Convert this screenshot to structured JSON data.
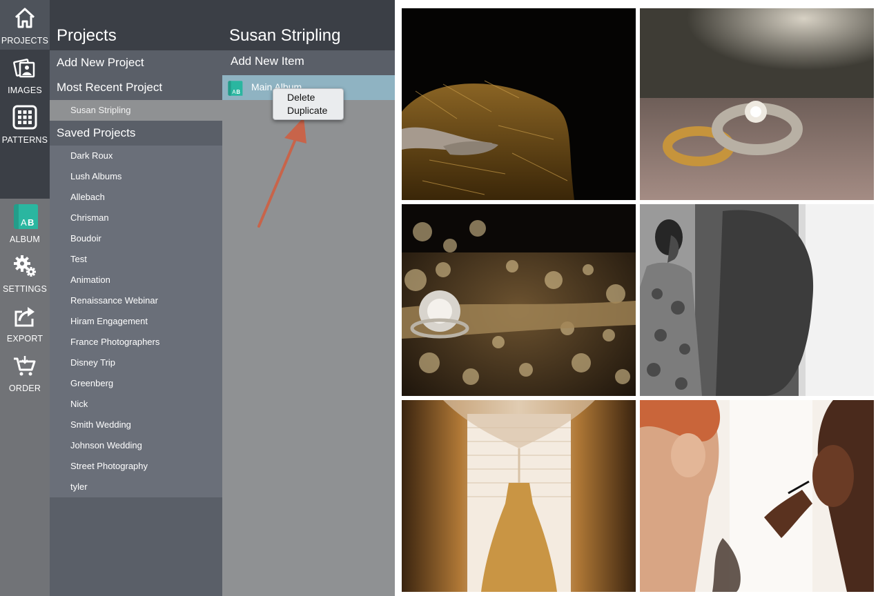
{
  "nav": {
    "items": [
      {
        "label": "PROJECTS",
        "icon": "home-icon",
        "active": true
      },
      {
        "label": "IMAGES",
        "icon": "photos-icon",
        "active": false
      },
      {
        "label": "PATTERNS",
        "icon": "grid-icon",
        "active": false
      },
      {
        "label": "ALBUM",
        "icon": "album-ab-icon",
        "active": false
      },
      {
        "label": "SETTINGS",
        "icon": "gears-icon",
        "active": false
      },
      {
        "label": "EXPORT",
        "icon": "share-icon",
        "active": false
      },
      {
        "label": "ORDER",
        "icon": "cart-icon",
        "active": false
      }
    ],
    "album_icon_text": "AB"
  },
  "projects": {
    "title": "Projects",
    "add_new": "Add New Project",
    "most_recent_heading": "Most Recent Project",
    "most_recent_item": "Susan Stripling",
    "saved_heading": "Saved Projects",
    "saved": [
      "Dark Roux",
      "Lush Albums",
      "Allebach",
      "Chrisman",
      "Boudoir",
      "Test",
      "Animation",
      "Renaissance Webinar",
      "Hiram Engagement",
      "France Photographers",
      "Disney Trip",
      "Greenberg",
      "Nick",
      "Smith Wedding",
      "Johnson Wedding",
      "Street Photography",
      "tyler"
    ]
  },
  "items": {
    "title": "Susan Stripling",
    "add_new": "Add New Item",
    "list": [
      {
        "label": "Main Album",
        "icon": "album-ab-icon"
      }
    ]
  },
  "context_menu": {
    "items": [
      "Delete",
      "Duplicate"
    ]
  },
  "gallery": {
    "photos": [
      {
        "name": "shoes-on-hay-photo"
      },
      {
        "name": "wedding-rings-photo"
      },
      {
        "name": "ring-on-sparkles-photo"
      },
      {
        "name": "bride-in-robe-photo"
      },
      {
        "name": "wedding-dress-window-photo"
      },
      {
        "name": "bride-makeup-photo"
      }
    ]
  },
  "colors": {
    "rail_dark": "#3b3f46",
    "panel": "#5a5f68",
    "selected": "#8fb3c2",
    "accent_teal": "#2ab6a0",
    "arrow": "#c8644a"
  }
}
